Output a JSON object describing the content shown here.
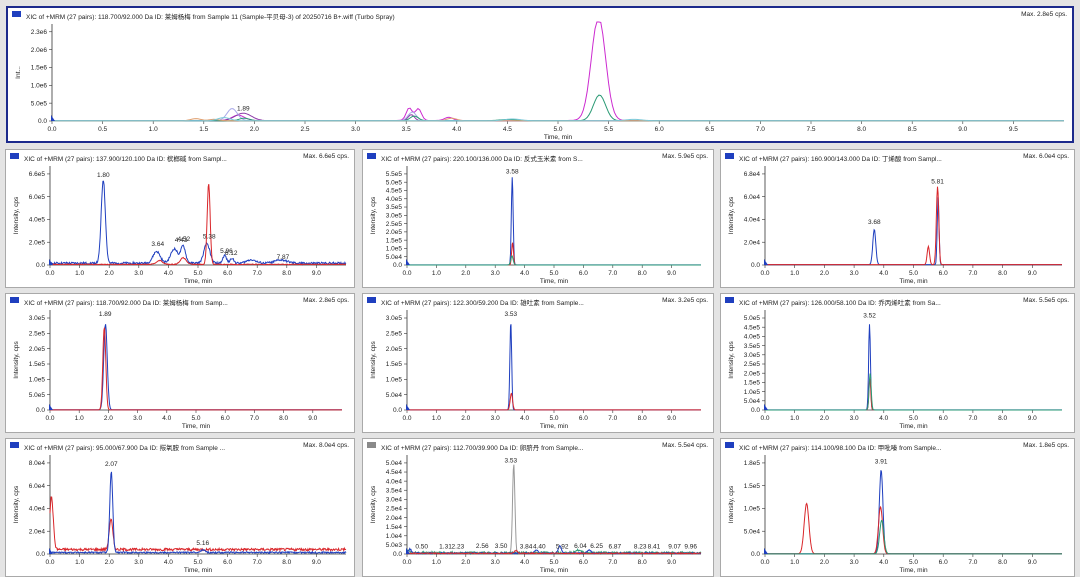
{
  "panes": [
    {
      "title": "XIC of +MRM (27 pairs): 118.700/92.000 Da ID: 莱姆杨梅 from Sample 11 (Sample-平贝母-3) of 20250716 B+.wiff (Turbo Spray)",
      "max": "Max. 2.8e5 cps.",
      "xlabel": "Time, min",
      "ylabel": "Int...",
      "icon": "blue",
      "selected": true,
      "xlim": [
        0,
        10
      ],
      "ylim": [
        0,
        250000.0
      ],
      "xstep": 0.5,
      "xdec": 1,
      "yticks": [
        "0.0",
        "5.0e5",
        "1.0e6",
        "1.5e6",
        "2.0e6",
        "2.3e6"
      ],
      "peak_labels": [
        {
          "x": 1.89,
          "y": 24000.0,
          "text": "1.89"
        }
      ],
      "series": [
        {
          "color": "#cc2ad0",
          "baseline": 1500,
          "peaks": [
            [
              1.84,
              15000,
              0.06
            ],
            [
              3.53,
              35000,
              0.03
            ],
            [
              3.62,
              33000,
              0.03
            ],
            [
              5.4,
              290000,
              0.07
            ],
            [
              3.92,
              9000,
              0.04
            ]
          ]
        },
        {
          "color": "#8c3aa8",
          "baseline": 900,
          "peaks": [
            [
              1.89,
              21000,
              0.08
            ],
            [
              3.55,
              17000,
              0.03
            ]
          ]
        },
        {
          "color": "#a9a9e8",
          "baseline": 1200,
          "peaks": [
            [
              1.78,
              34000,
              0.05
            ],
            [
              3.56,
              24000,
              0.04
            ]
          ]
        },
        {
          "color": "#2a9a74",
          "baseline": 800,
          "peaks": [
            [
              5.41,
              72000,
              0.06
            ],
            [
              3.58,
              13000,
              0.04
            ],
            [
              1.9,
              7000,
              0.05
            ],
            [
              4.5,
              3500,
              0.08
            ]
          ]
        },
        {
          "color": "#e0a070",
          "baseline": 700,
          "peaks": [
            [
              1.42,
              6000,
              0.05
            ],
            [
              3.95,
              7000,
              0.05
            ],
            [
              1.6,
              4000,
              0.05
            ]
          ]
        },
        {
          "color": "#7ac8d8",
          "baseline": 600,
          "peaks": [
            [
              4.55,
              5000,
              0.08
            ],
            [
              5.75,
              4000,
              0.08
            ],
            [
              1.7,
              9000,
              0.06
            ]
          ]
        }
      ]
    },
    {
      "title": "XIC of +MRM (27 pairs): 137.900/120.100 Da ID: 槟榔碱 from Sampl...",
      "max": "Max. 6.6e5 cps.",
      "xlabel": "Time, min",
      "ylabel": "Intensity, cps",
      "icon": "blue",
      "xlim": [
        0,
        10
      ],
      "ylim": [
        0,
        700000.0
      ],
      "xstep": 1,
      "xdec": 1,
      "yticks": [
        "0.0",
        "2.0e5",
        "4.0e5",
        "6.0e5",
        "6.6e5"
      ],
      "peak_labels": [
        {
          "x": 1.8,
          "y": 660000.0,
          "text": "1.80"
        },
        {
          "x": 3.64,
          "y": 130000.0,
          "text": "3.64"
        },
        {
          "x": 4.43,
          "y": 160000.0,
          "text": "4.43"
        },
        {
          "x": 4.52,
          "y": 170000.0,
          "text": "4.52"
        },
        {
          "x": 5.38,
          "y": 190000.0,
          "text": "5.38"
        },
        {
          "x": 5.96,
          "y": 75000.0,
          "text": "5.96"
        },
        {
          "x": 6.12,
          "y": 60000.0,
          "text": "6.12"
        },
        {
          "x": 7.87,
          "y": 30000.0,
          "text": "7.87"
        }
      ],
      "series": [
        {
          "color": "#1f3fbf",
          "baseline": 14000,
          "noise": 8000,
          "peaks": [
            [
              1.8,
              640000,
              0.07
            ],
            [
              3.6,
              90000,
              0.12
            ],
            [
              4.2,
              110000,
              0.12
            ],
            [
              4.5,
              130000,
              0.08
            ],
            [
              5.3,
              150000,
              0.1
            ],
            [
              5.9,
              60000,
              0.06
            ],
            [
              6.15,
              40000,
              0.06
            ],
            [
              6.8,
              28000,
              0.15
            ],
            [
              7.8,
              25000,
              0.2
            ]
          ]
        },
        {
          "color": "#d9262a",
          "baseline": 5000,
          "noise": 3000,
          "peaks": [
            [
              5.36,
              620000,
              0.05
            ],
            [
              4.5,
              50000,
              0.1
            ],
            [
              3.7,
              30000,
              0.1
            ]
          ]
        }
      ]
    },
    {
      "title": "XIC of +MRM (27 pairs): 220.100/136.000 Da ID: 反式玉米素 from S...",
      "max": "Max. 5.9e5 cps.",
      "xlabel": "Time, min",
      "ylabel": "Intensity, cps",
      "icon": "blue",
      "xlim": [
        0,
        10
      ],
      "ylim": [
        0,
        600000.0
      ],
      "xstep": 1,
      "xdec": 1,
      "yticks": [
        "0.0",
        "5.0e4",
        "1.0e5",
        "1.5e5",
        "2.0e5",
        "2.5e5",
        "3.0e5",
        "3.5e5",
        "4.0e5",
        "4.5e5",
        "5.0e5",
        "5.5e5"
      ],
      "peak_labels": [
        {
          "x": 3.58,
          "y": 590000.0,
          "text": "3.58"
        }
      ],
      "series": [
        {
          "color": "#1f3fbf",
          "baseline": 500,
          "peaks": [
            [
              3.58,
              580000,
              0.03
            ]
          ]
        },
        {
          "color": "#d9262a",
          "baseline": 300,
          "peaks": [
            [
              3.59,
              150000,
              0.03
            ]
          ]
        },
        {
          "color": "#2a9a74",
          "baseline": 300,
          "peaks": [
            [
              3.57,
              60000,
              0.04
            ]
          ]
        }
      ]
    },
    {
      "title": "XIC of +MRM (27 pairs): 160.900/143.000 Da ID: 丁烯酸 from Sampl...",
      "max": "Max. 6.0e4 cps.",
      "xlabel": "Time, min",
      "ylabel": "Intensity, cps",
      "icon": "blue",
      "xlim": [
        0,
        10
      ],
      "ylim": [
        0,
        70000.0
      ],
      "xstep": 1,
      "xdec": 1,
      "yticks": [
        "0.0",
        "2.0e4",
        "4.0e4",
        "6.0e4",
        "6.8e4"
      ],
      "peak_labels": [
        {
          "x": 3.68,
          "y": 30000.0,
          "text": "3.68"
        },
        {
          "x": 5.81,
          "y": 61000.0,
          "text": "5.81"
        }
      ],
      "series": [
        {
          "color": "#1f3fbf",
          "baseline": 300,
          "peaks": [
            [
              3.68,
              27000,
              0.05
            ],
            [
              5.83,
              52000,
              0.03
            ]
          ]
        },
        {
          "color": "#d9262a",
          "baseline": 300,
          "peaks": [
            [
              5.81,
              60000,
              0.04
            ],
            [
              5.5,
              14000,
              0.04
            ]
          ]
        }
      ]
    },
    {
      "title": "XIC of +MRM (27 pairs): 118.700/92.000 Da ID: 莱姆杨梅 from Samp...",
      "max": "Max. 2.8e5 cps.",
      "xlabel": "Time, min",
      "ylabel": "Intensity, cps",
      "icon": "blue",
      "xlim": [
        0,
        10
      ],
      "ylim": [
        0,
        300000.0
      ],
      "xstep": 1,
      "xdec": 1,
      "yticks": [
        "0.0",
        "5.0e5",
        "1.0e5",
        "1.5e5",
        "2.0e5",
        "2.5e5",
        "3.0e5"
      ],
      "peak_labels": [
        {
          "x": 1.89,
          "y": 300000.0,
          "text": "1.89"
        }
      ],
      "series": [
        {
          "color": "#1f3fbf",
          "baseline": 500,
          "peaks": [
            [
              1.9,
              280000,
              0.06
            ]
          ]
        },
        {
          "color": "#d9262a",
          "baseline": 300,
          "peaks": [
            [
              1.86,
              270000,
              0.05
            ]
          ]
        }
      ]
    },
    {
      "title": "XIC of +MRM (27 pairs): 122.300/59.200 Da ID: 雄吐素 from Sample...",
      "max": "Max. 3.2e5 cps.",
      "xlabel": "Time, min",
      "ylabel": "Intensity, cps",
      "icon": "blue",
      "xlim": [
        0,
        10
      ],
      "ylim": [
        0,
        330000.0
      ],
      "xstep": 1,
      "xdec": 1,
      "yticks": [
        "0.0",
        "5.0e4",
        "1.0e5",
        "1.5e5",
        "2.0e5",
        "2.5e5",
        "3.0e5"
      ],
      "peak_labels": [
        {
          "x": 3.53,
          "y": 330000.0,
          "text": "3.53"
        }
      ],
      "series": [
        {
          "color": "#1f3fbf",
          "baseline": 400,
          "peaks": [
            [
              3.53,
              320000,
              0.03
            ]
          ]
        },
        {
          "color": "#d9262a",
          "baseline": 300,
          "peaks": [
            [
              3.55,
              60000,
              0.04
            ]
          ]
        }
      ]
    },
    {
      "title": "XIC of +MRM (27 pairs): 126.000/58.100 Da ID: 乔丙烯吐素 from Sa...",
      "max": "Max. 5.5e5 cps.",
      "xlabel": "Time, min",
      "ylabel": "Intensity, cps",
      "icon": "blue",
      "xlim": [
        0,
        10
      ],
      "ylim": [
        0,
        580000.0
      ],
      "xstep": 1,
      "xdec": 1,
      "yticks": [
        "0.0",
        "5.0e4",
        "1.0e5",
        "1.5e5",
        "2.0e5",
        "2.5e5",
        "3.0e5",
        "3.5e5",
        "4.0e5",
        "4.5e5",
        "5.0e5"
      ],
      "peak_labels": [
        {
          "x": 3.52,
          "y": 570000.0,
          "text": "3.52"
        }
      ],
      "series": [
        {
          "color": "#1f3fbf",
          "baseline": 400,
          "peaks": [
            [
              3.52,
              540000,
              0.03
            ]
          ]
        },
        {
          "color": "#d9262a",
          "baseline": 300,
          "peaks": [
            [
              3.53,
              200000,
              0.03
            ]
          ]
        },
        {
          "color": "#2a9a74",
          "baseline": 300,
          "peaks": [
            [
              3.54,
              230000,
              0.035
            ]
          ]
        }
      ]
    },
    {
      "title": "XIC of +MRM (27 pairs): 95.000/67.900 Da ID: 羰氧胺 from Sample ...",
      "max": "Max. 8.0e4 cps.",
      "xlabel": "Time, min",
      "ylabel": "Intensity, cps",
      "icon": "blue",
      "xlim": [
        0,
        10
      ],
      "ylim": [
        0,
        90000.0
      ],
      "xstep": 1,
      "xdec": 1,
      "yticks": [
        "0.0",
        "2.0e4",
        "4.0e4",
        "6.0e4",
        "8.0e4"
      ],
      "peak_labels": [
        {
          "x": 2.07,
          "y": 85000.0,
          "text": "2.07"
        },
        {
          "x": 5.16,
          "y": 7000,
          "text": "5.16"
        }
      ],
      "series": [
        {
          "color": "#d9262a",
          "baseline": 4500,
          "noise": 1200,
          "peaks": [
            [
              0.05,
              52000,
              0.06
            ],
            [
              2.06,
              30000,
              0.06
            ]
          ]
        },
        {
          "color": "#1f3fbf",
          "baseline": 1500,
          "noise": 700,
          "peaks": [
            [
              2.07,
              80000,
              0.05
            ],
            [
              5.16,
              2500,
              0.08
            ]
          ]
        }
      ]
    },
    {
      "title": "XIC of +MRM (27 pairs): 112.700/39.900 Da ID: 卵脐丹 from Sample...",
      "max": "Max. 5.5e4 cps.",
      "xlabel": "Time, min",
      "ylabel": "Intensity, cps",
      "icon": "gray",
      "xlim": [
        0,
        10
      ],
      "ylim": [
        0,
        56000.0
      ],
      "xstep": 1,
      "xdec": 1,
      "yticks": [
        "0.0",
        "5.0e3",
        "1.0e4",
        "1.5e4",
        "2.0e4",
        "2.5e4",
        "3.0e4",
        "3.5e4",
        "4.0e4",
        "4.5e4",
        "5.0e4"
      ],
      "peak_labels": [
        {
          "x": 3.53,
          "y": 55000.0,
          "text": "3.53"
        },
        {
          "x": 0.5,
          "y": 2000,
          "text": "0.50"
        },
        {
          "x": 1.31,
          "y": 2000,
          "text": "1.31"
        },
        {
          "x": 1.73,
          "y": 2000,
          "text": "2.23"
        },
        {
          "x": 2.56,
          "y": 2500,
          "text": "2.56"
        },
        {
          "x": 3.2,
          "y": 2500,
          "text": "3.50"
        },
        {
          "x": 4.05,
          "y": 2000,
          "text": "3.84"
        },
        {
          "x": 4.5,
          "y": 2000,
          "text": "4.40"
        },
        {
          "x": 5.28,
          "y": 2000,
          "text": "5.92"
        },
        {
          "x": 5.9,
          "y": 2500,
          "text": "6.04"
        },
        {
          "x": 6.45,
          "y": 2500,
          "text": "6.25"
        },
        {
          "x": 7.07,
          "y": 2000,
          "text": "6.87"
        },
        {
          "x": 7.93,
          "y": 2000,
          "text": "8.23"
        },
        {
          "x": 8.4,
          "y": 2000,
          "text": "8.41"
        },
        {
          "x": 9.1,
          "y": 2000,
          "text": "9.07"
        },
        {
          "x": 9.65,
          "y": 2000,
          "text": "9.96"
        }
      ],
      "series": [
        {
          "color": "#9a9a9a",
          "baseline": 300,
          "peaks": [
            [
              3.63,
              55000,
              0.04
            ]
          ]
        },
        {
          "color": "#2a9a74",
          "baseline": 800,
          "noise": 600,
          "peaks": [
            [
              0.05,
              1800,
              0.05
            ],
            [
              5.8,
              1500,
              0.1
            ]
          ]
        },
        {
          "color": "#1f3fbf",
          "baseline": 500,
          "noise": 400,
          "peaks": [
            [
              5.2,
              4500,
              0.05
            ],
            [
              0.1,
              2500,
              0.05
            ],
            [
              4.4,
              2200,
              0.06
            ],
            [
              6.2,
              1800,
              0.06
            ]
          ]
        },
        {
          "color": "#d9262a",
          "baseline": 400,
          "noise": 300,
          "peaks": [
            [
              3.7,
              1800,
              0.05
            ]
          ]
        }
      ]
    },
    {
      "title": "XIC of +MRM (27 pairs): 114.100/98.100 Da ID: 甲吡嗪 from Sample...",
      "max": "Max. 1.8e5 cps.",
      "xlabel": "Time, min",
      "ylabel": "Intensity, cps",
      "icon": "blue",
      "xlim": [
        0,
        10
      ],
      "ylim": [
        0,
        190000.0
      ],
      "xstep": 1,
      "xdec": 1,
      "yticks": [
        "0.0",
        "5.0e4",
        "1.0e5",
        "1.5e5",
        "1.8e5"
      ],
      "peak_labels": [
        {
          "x": 3.91,
          "y": 185000.0,
          "text": "3.91"
        }
      ],
      "series": [
        {
          "color": "#1f3fbf",
          "baseline": 500,
          "peaks": [
            [
              3.91,
              175000,
              0.06
            ]
          ]
        },
        {
          "color": "#d9262a",
          "baseline": 400,
          "peaks": [
            [
              3.89,
              98000,
              0.07
            ],
            [
              1.4,
              105000,
              0.08
            ]
          ]
        },
        {
          "color": "#2a9a74",
          "baseline": 300,
          "peaks": [
            [
              3.93,
              70000,
              0.07
            ]
          ]
        }
      ]
    }
  ]
}
